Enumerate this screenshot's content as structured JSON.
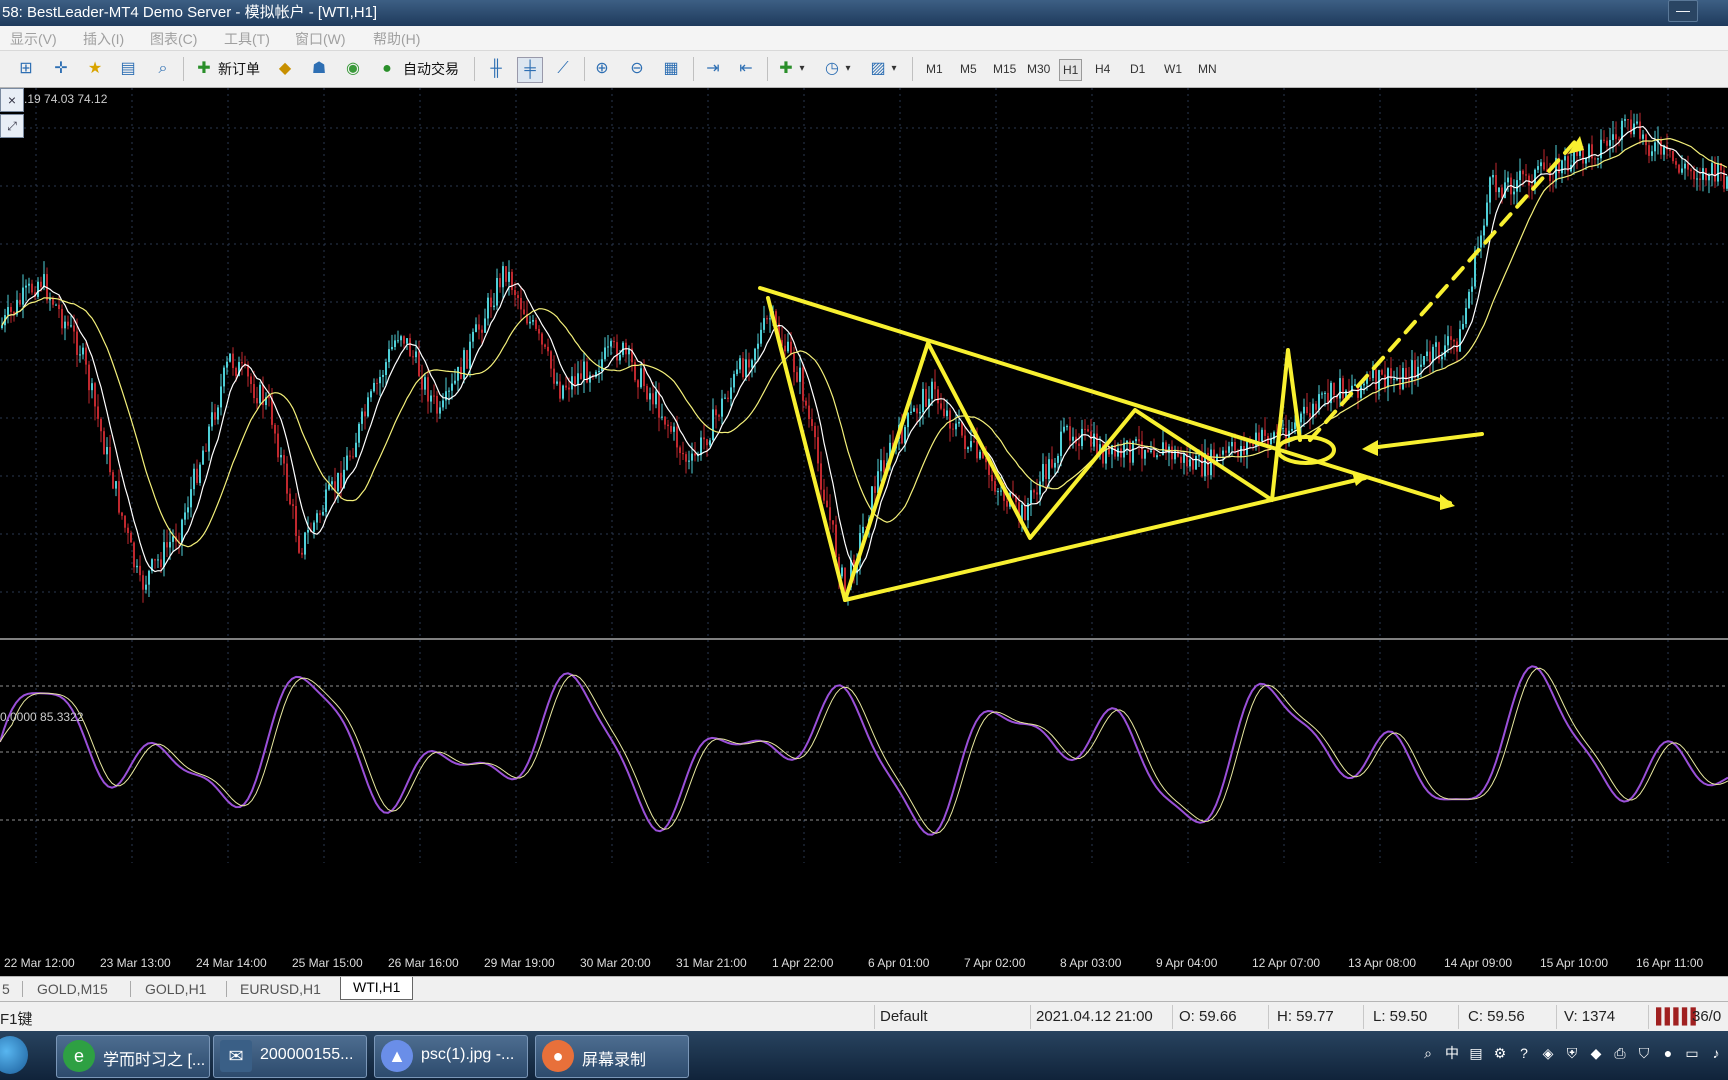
{
  "window": {
    "title": "58: BestLeader-MT4 Demo Server - 模拟帐户 - [WTI,H1]",
    "minimize_label": "—"
  },
  "menu": [
    "显示(V)",
    "插入(I)",
    "图表(C)",
    "工具(T)",
    "窗口(W)",
    "帮助(H)"
  ],
  "toolbar": {
    "new_order_label": "新订单",
    "auto_trade_label": "自动交易",
    "timeframes": [
      "M1",
      "M5",
      "M15",
      "M30",
      "H1",
      "H4",
      "D1",
      "W1",
      "MN"
    ],
    "active_timeframe": "H1"
  },
  "chart": {
    "ohlc_readout": ".19 74.03 74.12",
    "stoch_readout": "0.0000 85.3322",
    "close_icon": "×",
    "maximize_icon": "⤢",
    "x_labels": [
      "22 Mar 12:00",
      "23 Mar 13:00",
      "24 Mar 14:00",
      "25 Mar 15:00",
      "26 Mar 16:00",
      "29 Mar 19:00",
      "30 Mar 20:00",
      "31 Mar 21:00",
      "1 Apr 22:00",
      "6 Apr 01:00",
      "7 Apr 02:00",
      "8 Apr 03:00",
      "9 Apr 04:00",
      "12 Apr 07:00",
      "13 Apr 08:00",
      "14 Apr 09:00",
      "15 Apr 10:00",
      "16 Apr 11:00"
    ],
    "colors": {
      "background": "#000000",
      "grid": "#2a3850",
      "bull_candle": "#4fd0d8",
      "bear_candle": "#c0282e",
      "ma_fast": "#ffffff",
      "ma_slow": "#f4f07a",
      "annotation": "#f8f030",
      "stoch_main": "#9a50d8",
      "stoch_signal": "#e8e8a0"
    }
  },
  "tabs": {
    "items": [
      "5",
      "GOLD,M15",
      "GOLD,H1",
      "EURUSD,H1",
      "WTI,H1"
    ],
    "active": "WTI,H1"
  },
  "status": {
    "help": "F1键",
    "profile": "Default",
    "datetime": "2021.04.12 21:00",
    "open": "O: 59.66",
    "high": "H: 59.77",
    "low": "L: 59.50",
    "close": "C: 59.56",
    "volume": "V: 1374",
    "traffic": "36/0"
  },
  "taskbar": {
    "items": [
      {
        "label": "学而时习之 [...",
        "icon": "e"
      },
      {
        "label": "200000155...",
        "icon": "✉"
      },
      {
        "label": "psc(1).jpg -...",
        "icon": "▲"
      },
      {
        "label": "屏幕录制",
        "icon": "●"
      }
    ],
    "tray_text": "中"
  }
}
